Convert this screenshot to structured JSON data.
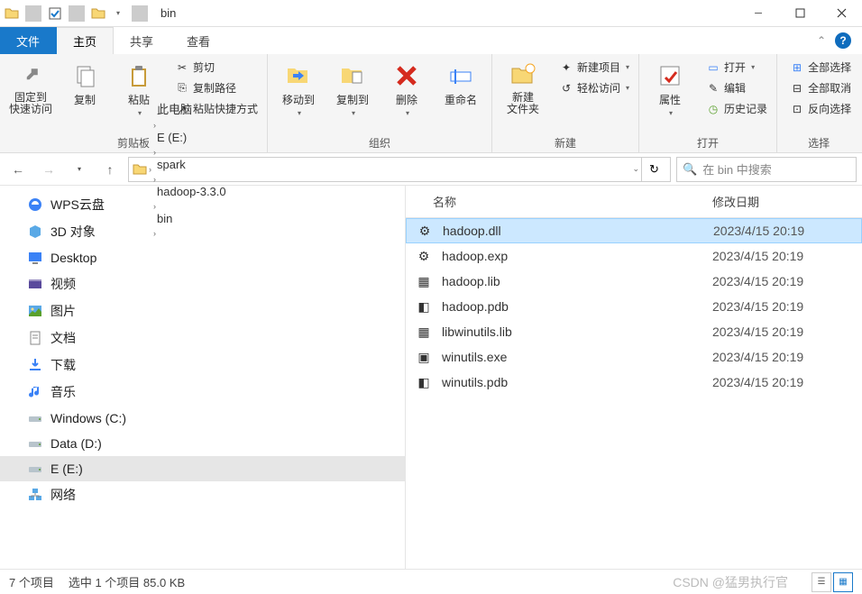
{
  "title": "bin",
  "tabs": {
    "file": "文件",
    "home": "主页",
    "share": "共享",
    "view": "查看"
  },
  "ribbon": {
    "clipboard": {
      "pin": "固定到",
      "pin2": "快速访问",
      "copy": "复制",
      "paste": "粘贴",
      "cut": "剪切",
      "copypath": "复制路径",
      "pasteshortcut": "粘贴快捷方式",
      "label": "剪贴板"
    },
    "organize": {
      "moveto": "移动到",
      "copyto": "复制到",
      "delete": "删除",
      "rename": "重命名",
      "label": "组织"
    },
    "new": {
      "newfolder": "新建",
      "newfolder2": "文件夹",
      "newitem": "新建项目",
      "easyaccess": "轻松访问",
      "label": "新建"
    },
    "open": {
      "properties": "属性",
      "open": "打开",
      "edit": "编辑",
      "history": "历史记录",
      "label": "打开"
    },
    "select": {
      "selectall": "全部选择",
      "selectnone": "全部取消",
      "invert": "反向选择",
      "label": "选择"
    }
  },
  "breadcrumb": [
    "此电脑",
    "E (E:)",
    "spark",
    "hadoop-3.3.0",
    "bin"
  ],
  "search": {
    "placeholder": "在 bin 中搜索"
  },
  "tree": [
    {
      "icon": "wps",
      "label": "WPS云盘"
    },
    {
      "icon": "3d",
      "label": "3D 对象"
    },
    {
      "icon": "desktop",
      "label": "Desktop"
    },
    {
      "icon": "video",
      "label": "视频"
    },
    {
      "icon": "pic",
      "label": "图片"
    },
    {
      "icon": "doc",
      "label": "文档"
    },
    {
      "icon": "dl",
      "label": "下载"
    },
    {
      "icon": "music",
      "label": "音乐"
    },
    {
      "icon": "drive",
      "label": "Windows (C:)"
    },
    {
      "icon": "drive",
      "label": "Data (D:)"
    },
    {
      "icon": "drive",
      "label": "E (E:)",
      "sel": true
    },
    {
      "icon": "net",
      "label": "网络"
    }
  ],
  "columns": {
    "name": "名称",
    "date": "修改日期"
  },
  "files": [
    {
      "name": "hadoop.dll",
      "date": "2023/4/15 20:19",
      "sel": true,
      "icon": "dll"
    },
    {
      "name": "hadoop.exp",
      "date": "2023/4/15 20:19",
      "icon": "exp"
    },
    {
      "name": "hadoop.lib",
      "date": "2023/4/15 20:19",
      "icon": "lib"
    },
    {
      "name": "hadoop.pdb",
      "date": "2023/4/15 20:19",
      "icon": "pdb"
    },
    {
      "name": "libwinutils.lib",
      "date": "2023/4/15 20:19",
      "icon": "lib"
    },
    {
      "name": "winutils.exe",
      "date": "2023/4/15 20:19",
      "icon": "exe"
    },
    {
      "name": "winutils.pdb",
      "date": "2023/4/15 20:19",
      "icon": "pdb"
    }
  ],
  "status": {
    "count": "7 个项目",
    "selected": "选中 1 个项目  85.0 KB",
    "watermark": "CSDN @猛男执行官"
  }
}
